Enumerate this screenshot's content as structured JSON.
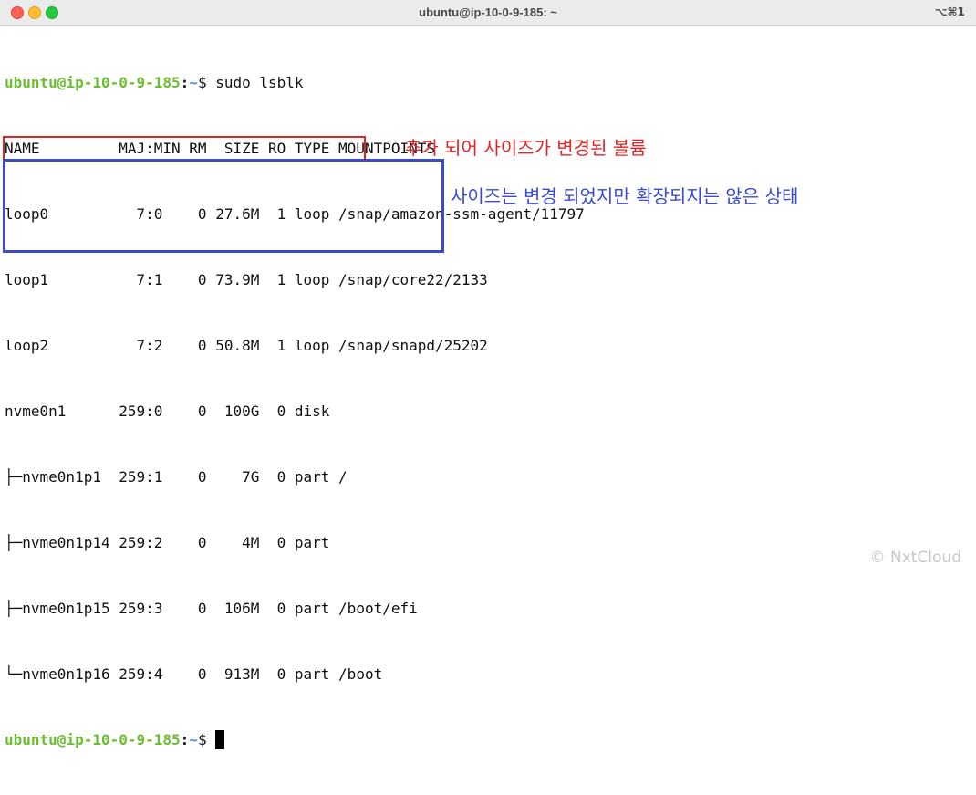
{
  "window": {
    "title": "ubuntu@ip-10-0-9-185: ~",
    "shortcut": "⌥⌘1"
  },
  "prompt": {
    "user_host": "ubuntu@ip-10-0-9-185",
    "colon": ":",
    "path": "~",
    "symbol": "$ "
  },
  "command": "sudo lsblk",
  "output_lines": [
    "NAME         MAJ:MIN RM  SIZE RO TYPE MOUNTPOINTS",
    "loop0          7:0    0 27.6M  1 loop /snap/amazon-ssm-agent/11797",
    "loop1          7:1    0 73.9M  1 loop /snap/core22/2133",
    "loop2          7:2    0 50.8M  1 loop /snap/snapd/25202",
    "nvme0n1      259:0    0  100G  0 disk",
    "├─nvme0n1p1  259:1    0    7G  0 part /",
    "├─nvme0n1p14 259:2    0    4M  0 part",
    "├─nvme0n1p15 259:3    0  106M  0 part /boot/efi",
    "└─nvme0n1p16 259:4    0  913M  0 part /boot"
  ],
  "annotations": {
    "red_note": "추가 되어 사이즈가 변경된 볼륨",
    "blue_note": "사이즈는 변경 되었지만 확장되지는 않은 상태",
    "red_color": "#e12525",
    "blue_color": "#3c4bcc"
  },
  "watermark": "© NxtCloud"
}
